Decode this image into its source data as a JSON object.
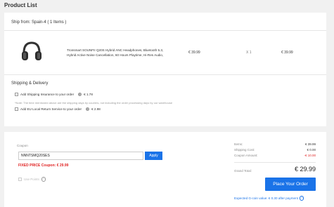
{
  "page": {
    "title": "Product List"
  },
  "shipment": {
    "ship_from": "Ship from: Spain-4 ( 1 Items )",
    "product": {
      "name": "Tronsmart SOUNFII Q20S Hybrid ANC Headphones, Bluetooth 5.3, Hybrid Active Noise Cancellation, 60 Hours Playtime, Hi-Res Audio,",
      "price": "€ 39.99",
      "quantity": "X 1",
      "subtotal": "€ 39.99",
      "icon": "headphones-icon"
    }
  },
  "shipping_delivery": {
    "title": "Shipping & Delivery",
    "insurance_label": "Add Shipping Insurance to your order",
    "insurance_price": "€ 1.78",
    "note": "*Note: The time mentioned above are the shipping days by couriers, not including the order processing days by our warehouse",
    "return_label": "Add EU Local Return Service to your order",
    "return_price": "€ 2.98"
  },
  "coupon": {
    "label": "Coupon",
    "value": "NNNTSMQ20SES",
    "apply_label": "Apply",
    "applied_text": "FIXED PRICE Coupon: € 29.99",
    "use_points_label": "Use Points"
  },
  "summary": {
    "items_label": "Items:",
    "items_value": "€ 39.99",
    "shipping_label": "Shipping Cost:",
    "shipping_value": "€ 0.00",
    "coupon_label": "Coupon Amount:",
    "coupon_value": "-€ 10.00",
    "grand_label": "Grand Total:",
    "grand_value": "€ 29.99",
    "order_button": "Place Your Order",
    "gcoin_text": "Expected G-coin value: € 0.30 after payment"
  },
  "colors": {
    "accent": "#1a73e8",
    "discount": "#e02424",
    "background": "#f1f1f1"
  }
}
